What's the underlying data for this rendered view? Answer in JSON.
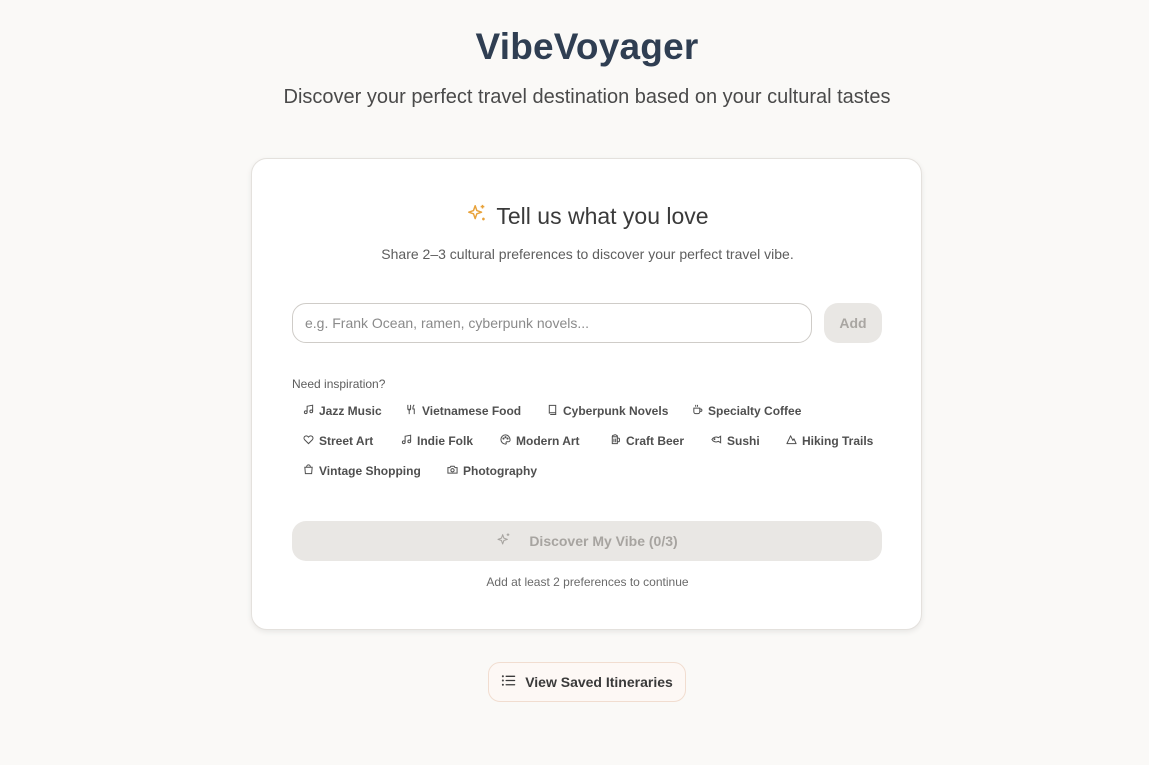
{
  "header": {
    "title": "VibeVoyager",
    "subtitle": "Discover your perfect travel destination based on your cultural tastes"
  },
  "card": {
    "icon": "sparkles-icon",
    "accent_color": "#e8a23a",
    "title": "Tell us what you love",
    "description": "Share 2–3 cultural preferences to discover your perfect travel vibe.",
    "input": {
      "value": "",
      "placeholder": "e.g. Frank Ocean, ramen, cyberpunk novels..."
    },
    "add_label": "Add",
    "inspiration_label": "Need inspiration?",
    "chips": [
      {
        "label": "Jazz Music",
        "icon": "music-note-icon"
      },
      {
        "label": "Vietnamese Food",
        "icon": "utensils-icon"
      },
      {
        "label": "Cyberpunk Novels",
        "icon": "book-icon"
      },
      {
        "label": "Specialty Coffee",
        "icon": "coffee-icon"
      },
      {
        "label": "Street Art",
        "icon": "heart-icon"
      },
      {
        "label": "Indie Folk",
        "icon": "music-note-icon"
      },
      {
        "label": "Modern Art",
        "icon": "palette-icon"
      },
      {
        "label": "Craft Beer",
        "icon": "beer-icon"
      },
      {
        "label": "Sushi",
        "icon": "fish-icon"
      },
      {
        "label": "Hiking Trails",
        "icon": "mountain-icon"
      },
      {
        "label": "Vintage Shopping",
        "icon": "shopping-bag-icon"
      },
      {
        "label": "Photography",
        "icon": "camera-icon"
      }
    ],
    "discover_label": "Discover My Vibe (0/3)",
    "hint": "Add at least 2 preferences to continue"
  },
  "footer": {
    "saved_label": "View Saved Itineraries",
    "saved_icon": "list-icon"
  }
}
